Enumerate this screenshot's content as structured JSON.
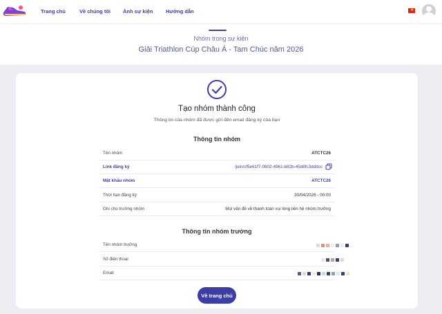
{
  "nav": {
    "items": [
      "Trang chủ",
      "Về chúng tôi",
      "Ảnh sự kiện",
      "Hướng dẫn"
    ],
    "logo_icon": "running-shoe-logo",
    "language_icon": "vietnam-flag-icon",
    "avatar_icon": "user-avatar-icon"
  },
  "hero": {
    "subtitle": "Nhóm trong sự kiện",
    "title": "Giải Triathlon Cúp Châu Á - Tam Chúc năm 2026"
  },
  "success": {
    "icon": "check-circle-icon",
    "title": "Tạo nhóm thành công",
    "subtitle": "Thông tin của nhóm đã được gửi đến email đăng ký của bạn"
  },
  "group_info": {
    "title": "Thông tin nhóm",
    "rows": [
      {
        "label": "Tên nhóm",
        "value": "ATCTC26"
      },
      {
        "label": "Link đăng ký",
        "value": "/join/cf5e61f7-0802-4961-b82b-45d8fc3dddcc"
      },
      {
        "label": "Mật khẩu nhóm",
        "value": "ATCTC26"
      },
      {
        "label": "Thời hạn đăng ký",
        "value": "30/04/2026 - 00:00"
      },
      {
        "label": "Ghi chú trưởng nhóm",
        "value": "Mọi vấn đề về thanh toán vui lòng liên hệ nhóm trưởng"
      }
    ]
  },
  "leader_info": {
    "title": "Thông tin nhóm trưởng",
    "rows": [
      {
        "label": "Tên nhóm trưởng"
      },
      {
        "label": "Số điện thoại"
      },
      {
        "label": "Email"
      }
    ]
  },
  "home_button": "Về trang chủ",
  "colors": {
    "accent": "#3b3ea5",
    "background": "#ecedf3"
  }
}
